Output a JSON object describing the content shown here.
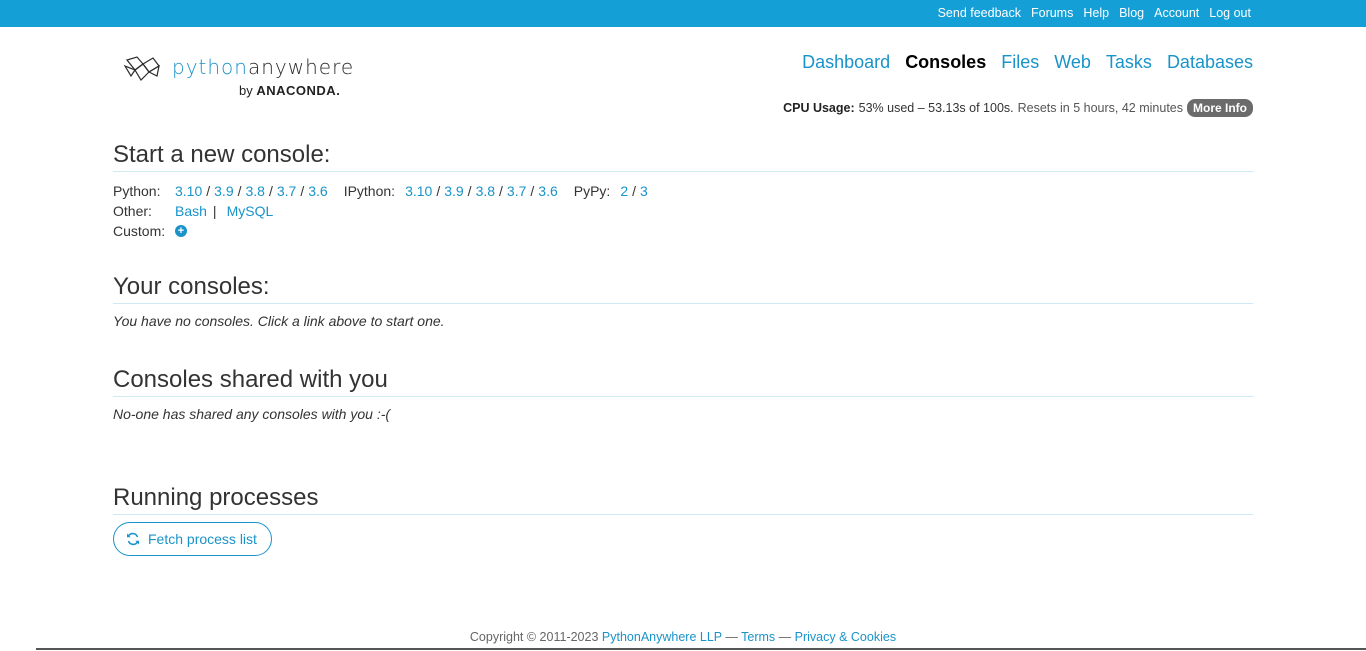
{
  "topbar": {
    "links": [
      "Send feedback",
      "Forums",
      "Help",
      "Blog",
      "Account",
      "Log out"
    ]
  },
  "logo": {
    "word_part1": "python",
    "word_part2": "anywhere",
    "by": "by",
    "brand": "ANACONDA."
  },
  "nav": {
    "items": [
      "Dashboard",
      "Consoles",
      "Files",
      "Web",
      "Tasks",
      "Databases"
    ],
    "active": "Consoles"
  },
  "cpu": {
    "label": "CPU Usage:",
    "used": "53% used – 53.13s of 100s.",
    "resets": "Resets in 5 hours, 42 minutes",
    "more_info": "More Info"
  },
  "new_console": {
    "title": "Start a new console:",
    "python_label": "Python:",
    "python_versions": [
      "3.10",
      "3.9",
      "3.8",
      "3.7",
      "3.6"
    ],
    "ipython_label": "IPython:",
    "ipython_versions": [
      "3.10",
      "3.9",
      "3.8",
      "3.7",
      "3.6"
    ],
    "pypy_label": "PyPy:",
    "pypy_versions": [
      "2",
      "3"
    ],
    "other_label": "Other:",
    "other_items": [
      "Bash",
      "MySQL"
    ],
    "custom_label": "Custom:"
  },
  "your_consoles": {
    "title": "Your consoles:",
    "empty": "You have no consoles. Click a link above to start one."
  },
  "shared": {
    "title": "Consoles shared with you",
    "empty": "No-one has shared any consoles with you :-("
  },
  "processes": {
    "title": "Running processes",
    "fetch_label": "Fetch process list"
  },
  "footer": {
    "copyright": "Copyright © 2011-2023",
    "company": "PythonAnywhere LLP",
    "dash": "—",
    "terms": "Terms",
    "privacy": "Privacy & Cookies"
  },
  "colors": {
    "topbar": "#159fd7",
    "link": "#1a93c9"
  }
}
